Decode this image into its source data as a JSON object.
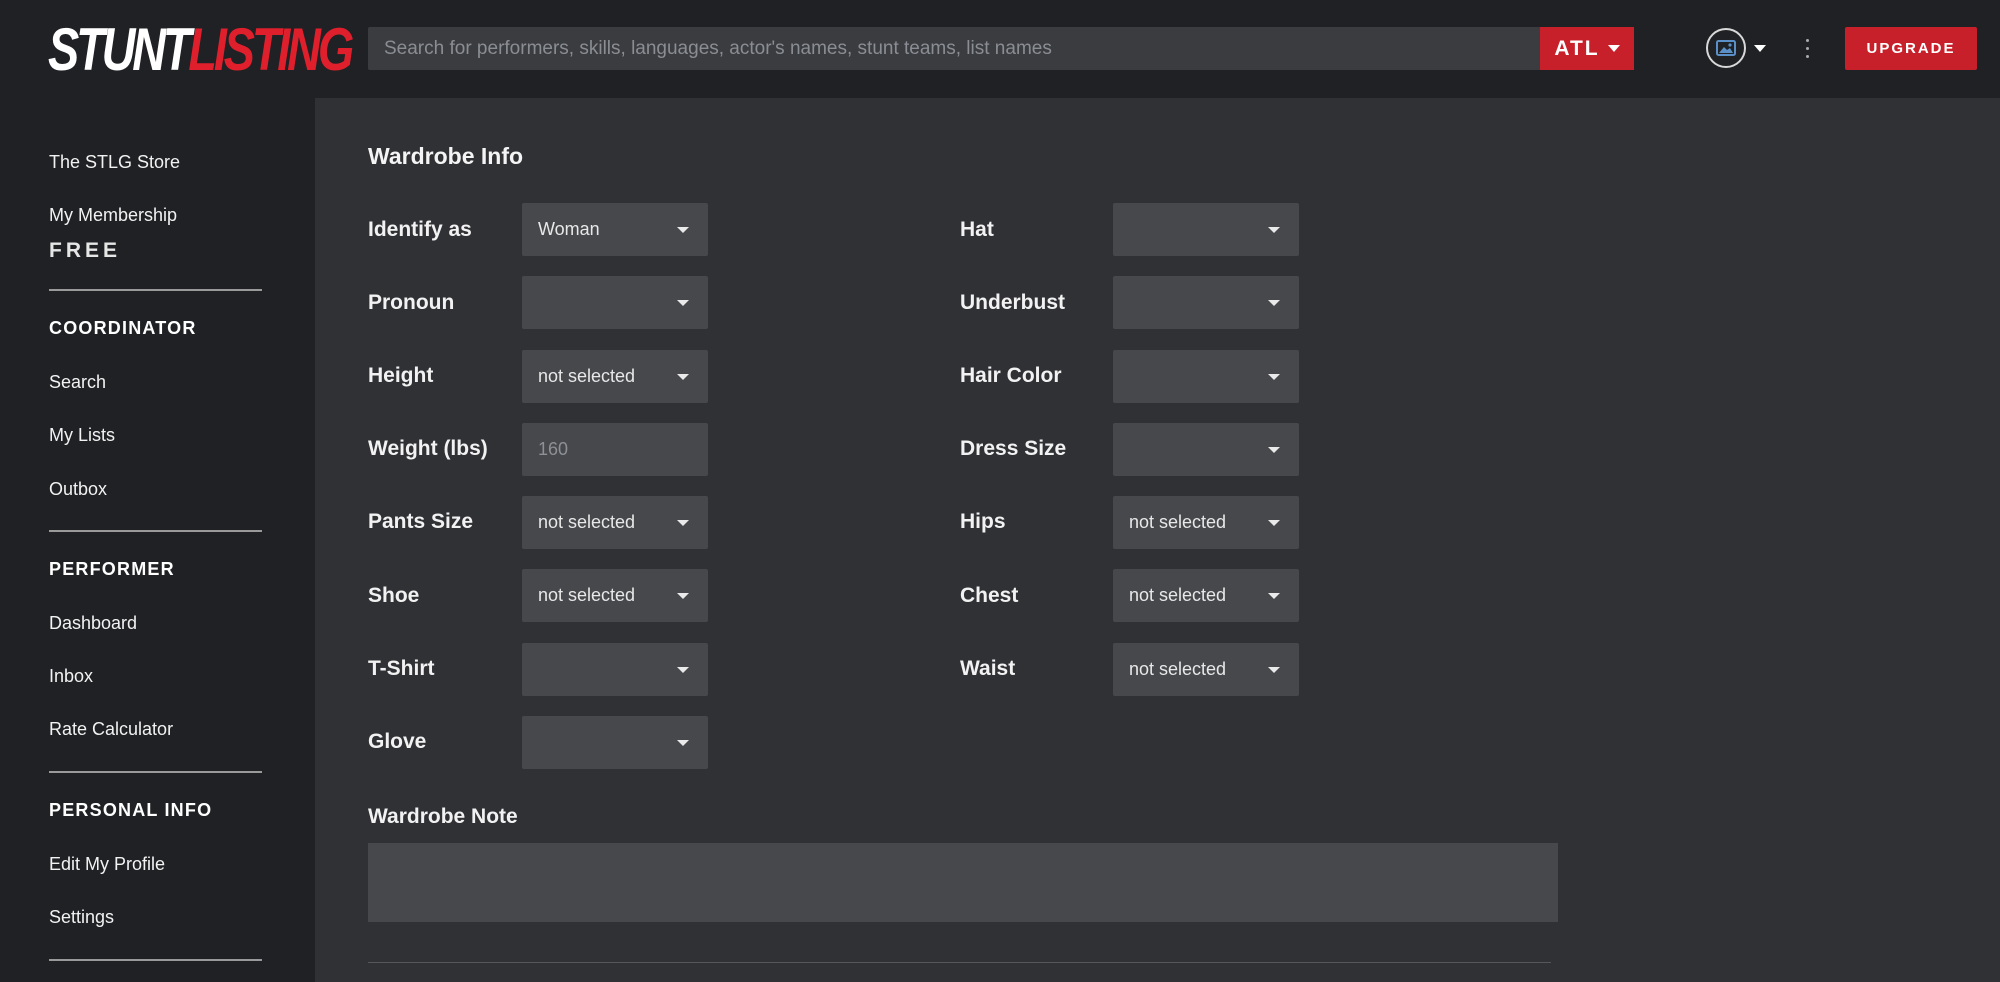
{
  "header": {
    "logo_part1": "STUNT",
    "logo_part2": "LISTING",
    "search_placeholder": "Search for performers, skills, languages, actor's names, stunt teams, list names",
    "region_label": "ATL",
    "upgrade_label": "UPGRADE"
  },
  "sidebar": {
    "store": "The STLG Store",
    "membership": "My Membership",
    "tier": "FREE",
    "sections": {
      "coordinator": {
        "title": "COORDINATOR",
        "items": [
          "Search",
          "My Lists",
          "Outbox"
        ]
      },
      "performer": {
        "title": "PERFORMER",
        "items": [
          "Dashboard",
          "Inbox",
          "Rate Calculator"
        ]
      },
      "personal": {
        "title": "PERSONAL INFO",
        "items": [
          "Edit My Profile",
          "Settings"
        ]
      }
    }
  },
  "main": {
    "title": "Wardrobe Info",
    "left_fields": [
      {
        "label": "Identify as",
        "value": "Woman"
      },
      {
        "label": "Pronoun",
        "value": ""
      },
      {
        "label": "Height",
        "value": "not selected"
      },
      {
        "label": "Weight (lbs)",
        "placeholder": "160"
      },
      {
        "label": "Pants Size",
        "value": "not selected"
      },
      {
        "label": "Shoe",
        "value": "not selected"
      },
      {
        "label": "T-Shirt",
        "value": ""
      },
      {
        "label": "Glove",
        "value": ""
      }
    ],
    "right_fields": [
      {
        "label": "Hat",
        "value": ""
      },
      {
        "label": "Underbust",
        "value": ""
      },
      {
        "label": "Hair Color",
        "value": ""
      },
      {
        "label": "Dress Size",
        "value": ""
      },
      {
        "label": "Hips",
        "value": "not selected"
      },
      {
        "label": "Chest",
        "value": "not selected"
      },
      {
        "label": "Waist",
        "value": "not selected"
      }
    ],
    "note_label": "Wardrobe Note"
  },
  "colors": {
    "accent": "#c8202b",
    "logo_red": "#e01f2d",
    "background": "#2f3135",
    "sidebar": "#1f2124",
    "control": "#46484c"
  }
}
